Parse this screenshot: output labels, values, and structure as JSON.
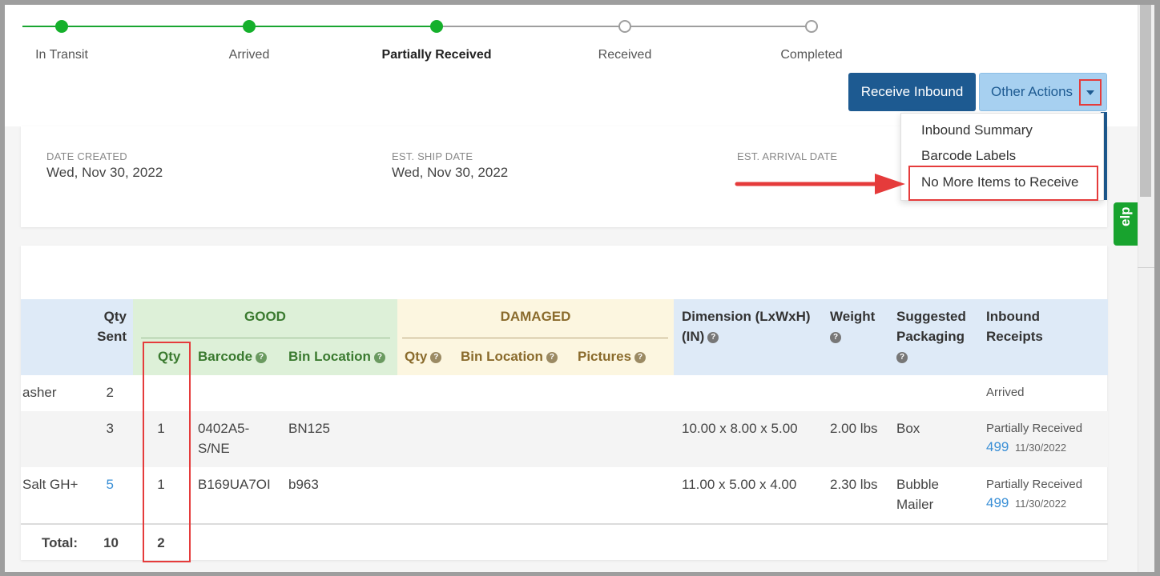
{
  "progress": {
    "steps": [
      {
        "label": "In Transit",
        "state": "done"
      },
      {
        "label": "Arrived",
        "state": "done"
      },
      {
        "label": "Partially Received",
        "state": "current"
      },
      {
        "label": "Received",
        "state": "todo"
      },
      {
        "label": "Completed",
        "state": "todo"
      }
    ]
  },
  "actions": {
    "receive_label": "Receive Inbound",
    "other_label": "Other Actions",
    "dropdown": [
      "Inbound Summary",
      "Barcode Labels",
      "No More Items to Receive"
    ]
  },
  "info": {
    "date_created_label": "DATE CREATED",
    "date_created": "Wed, Nov 30, 2022",
    "ship_date_label": "EST. SHIP DATE",
    "ship_date": "Wed, Nov 30, 2022",
    "arrival_label": "EST. ARRIVAL DATE"
  },
  "help_tab": "elp",
  "table": {
    "qty_sent": "Qty Sent",
    "group_good": "GOOD",
    "group_damaged": "DAMAGED",
    "good_cols": [
      "Qty",
      "Barcode",
      "Bin Location"
    ],
    "damaged_cols": [
      "Qty",
      "Bin Location",
      "Pictures"
    ],
    "dimension": "Dimension (LxWxH) (IN)",
    "dimension_l1": "Dimension (LxWxH)",
    "dimension_l2": "(IN)",
    "weight": "Weight",
    "packaging_l1": "Suggested",
    "packaging_l2": "Packaging",
    "receipts_l1": "Inbound",
    "receipts_l2": "Receipts",
    "rows": [
      {
        "name": "asher",
        "sent": "2",
        "good_qty": "",
        "barcode": "",
        "bin": "",
        "dimension": "",
        "weight": "",
        "packaging": "",
        "status": "Arrived",
        "receipt": "",
        "receipt_date": ""
      },
      {
        "name": "",
        "sent": "3",
        "good_qty": "1",
        "barcode": "0402A5-S/NE",
        "barcode_l1": "0402A5-",
        "barcode_l2": "S/NE",
        "bin": "BN125",
        "dimension": "10.00 x 8.00 x 5.00",
        "weight": "2.00 lbs",
        "packaging": "Box",
        "status": "Partially Received",
        "receipt": "499",
        "receipt_date": "11/30/2022"
      },
      {
        "name": "Salt GH+",
        "sent": "5",
        "good_qty": "1",
        "barcode": "B169UA7OI",
        "bin": "b963",
        "dimension": "11.00 x 5.00 x 4.00",
        "weight": "2.30 lbs",
        "packaging": "Bubble Mailer",
        "packaging_l1": "Bubble",
        "packaging_l2": "Mailer",
        "status": "Partially Received",
        "receipt": "499",
        "receipt_date": "11/30/2022"
      }
    ],
    "total_label": "Total:",
    "total_sent": "10",
    "total_good": "2"
  },
  "colors": {
    "primary": "#1d5a91",
    "success": "#15b02b",
    "highlight": "#e53b3b",
    "link": "#3a8fd6"
  }
}
